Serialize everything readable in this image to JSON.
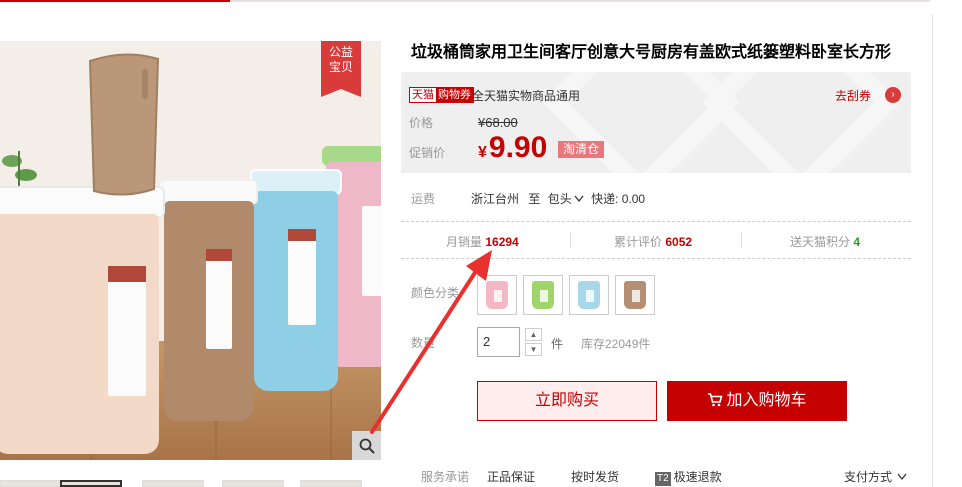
{
  "badge": {
    "line1": "公益",
    "line2": "宝贝"
  },
  "title": "垃圾桶筒家用卫生间客厅创意大号厨房有盖欧式纸篓塑料卧室长方形",
  "promo": {
    "tmall_a": "天猫",
    "tmall_b": "购物券",
    "tmall_text": "全天猫实物商品通用",
    "coupon": "去刮券",
    "coupon_icon": "›"
  },
  "price": {
    "label": "价格",
    "old": "¥68.00",
    "promo_label": "促销价",
    "currency": "¥",
    "now": "9.90",
    "tag": "淘清仓"
  },
  "shipping": {
    "label": "运费",
    "from": "浙江台州",
    "to_word": "至",
    "to": "包头",
    "express": "快递: 0.00"
  },
  "stats": {
    "monthly_label": "月销量",
    "monthly_value": "16294",
    "reviews_label": "累计评价",
    "reviews_value": "6052",
    "points_label": "送天猫积分",
    "points_value": "4"
  },
  "options": {
    "color_label": "颜色分类",
    "swatches": [
      "#f3b8c6",
      "#9fd46b",
      "#a9d7ea",
      "#b48f73"
    ]
  },
  "quantity": {
    "label": "数量",
    "value": "2",
    "up": "▲",
    "down": "▼",
    "unit": "件",
    "stock": "库存22049件"
  },
  "actions": {
    "buy": "立即购买",
    "cart": "加入购物车"
  },
  "service": {
    "label": "服务承诺",
    "item1": "正品保证",
    "item2": "按时发货",
    "t2": "T2",
    "item3": "极速退款",
    "payment": "支付方式"
  },
  "colors": {
    "accent": "#c40000",
    "badge": "#d93b3b",
    "arrow": "#e8302e"
  }
}
